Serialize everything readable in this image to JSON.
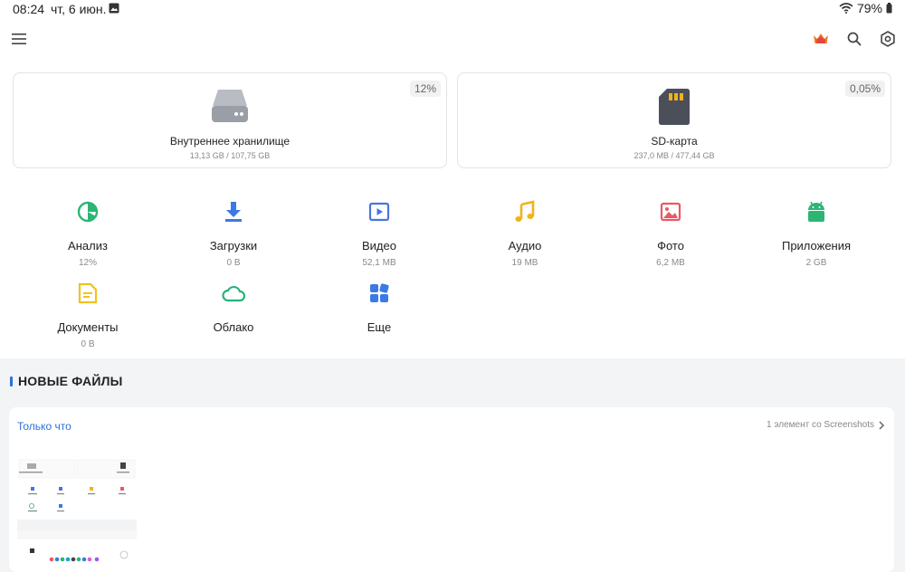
{
  "status": {
    "time": "08:24",
    "date": "чт, 6 июн.",
    "battery": "79%"
  },
  "storage": [
    {
      "name": "Внутреннее хранилище",
      "usage": "13,13 GB / 107,75 GB",
      "percent": "12%"
    },
    {
      "name": "SD-карта",
      "usage": "237,0 MB / 477,44 GB",
      "percent": "0,05%"
    }
  ],
  "categories": [
    {
      "label": "Анализ",
      "value": "12%",
      "icon": "analysis-icon",
      "color": "#2bb673"
    },
    {
      "label": "Загрузки",
      "value": "0 B",
      "icon": "download-icon",
      "color": "#3b7ae6"
    },
    {
      "label": "Видео",
      "value": "52,1 MB",
      "icon": "video-icon",
      "color": "#4a74e0"
    },
    {
      "label": "Аудио",
      "value": "19 MB",
      "icon": "music-icon",
      "color": "#f2b21b"
    },
    {
      "label": "Фото",
      "value": "6,2 MB",
      "icon": "photo-icon",
      "color": "#e85a63"
    },
    {
      "label": "Приложения",
      "value": "2 GB",
      "icon": "android-icon",
      "color": "#2bb673"
    },
    {
      "label": "Документы",
      "value": "0 B",
      "icon": "document-icon",
      "color": "#f2c21b"
    },
    {
      "label": "Облако",
      "value": "",
      "icon": "cloud-icon",
      "color": "#2bb07a"
    },
    {
      "label": "Еще",
      "value": "",
      "icon": "more-grid-icon",
      "color": "#3b7ae6"
    }
  ],
  "recent": {
    "section_title": "НОВЫЕ ФАЙЛЫ",
    "group_label": "Только что",
    "group_info": "1 элемент со Screenshots"
  }
}
